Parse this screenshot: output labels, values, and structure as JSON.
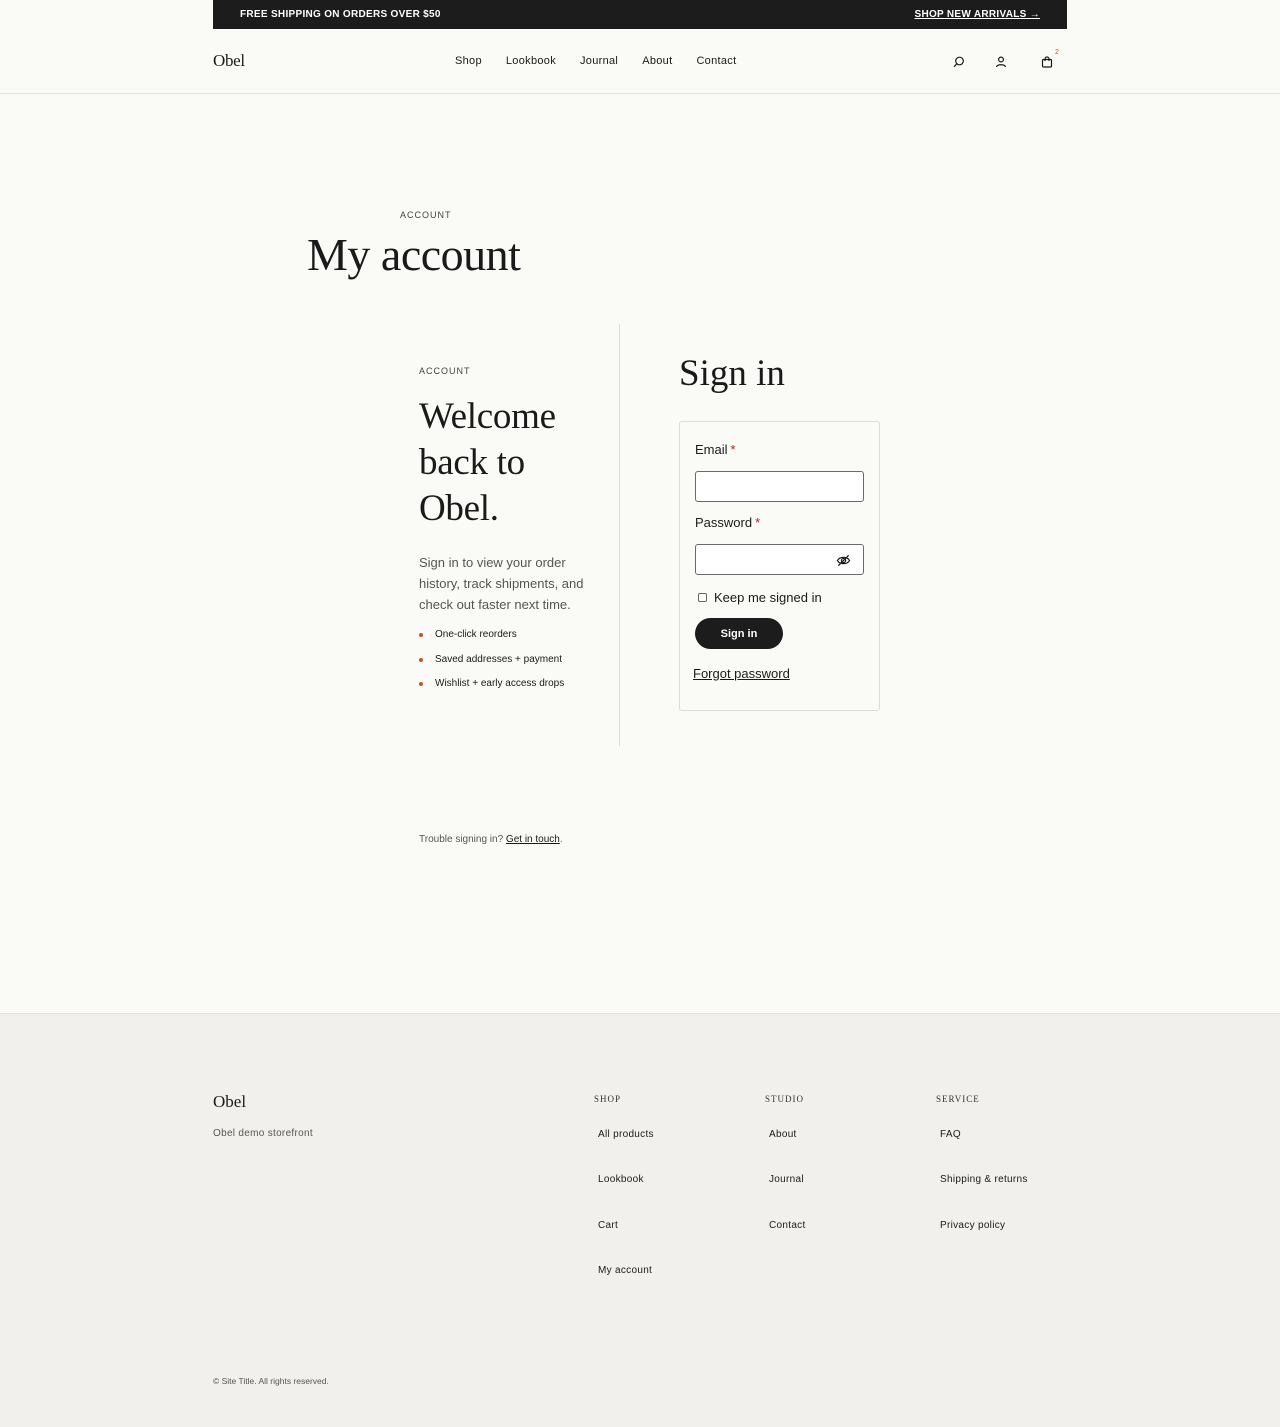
{
  "announcement": {
    "text": "FREE SHIPPING ON ORDERS OVER $50",
    "link": "SHOP NEW ARRIVALS →"
  },
  "header": {
    "logo": "Obel",
    "nav": [
      "Shop",
      "Lookbook",
      "Journal",
      "About",
      "Contact"
    ],
    "icons": [
      "search-icon",
      "account-icon",
      "bag-icon"
    ],
    "cart_count": "2"
  },
  "page": {
    "eyebrow": "ACCOUNT",
    "title": "My account"
  },
  "welcome": {
    "eyebrow": "ACCOUNT",
    "heading": "Welcome back to Obel.",
    "intro": "Sign in to view your order history, track shipments, and check out faster next time.",
    "perks": [
      "One-click reorders",
      "Saved addresses + payment",
      "Wishlist + early access drops"
    ],
    "accent_color": "#c2552b"
  },
  "signin": {
    "title": "Sign in",
    "email_label": "Email",
    "password_label": "Password",
    "required_mark": "*",
    "keep_signed_in": "Keep me signed in",
    "button": "Sign in",
    "forgot": "Forgot password"
  },
  "trouble": {
    "text": "Trouble signing in?",
    "link": "Get in touch",
    "suffix": "."
  },
  "footer": {
    "logo": "Obel",
    "tagline": "Obel demo storefront",
    "columns": [
      {
        "title": "SHOP",
        "links": [
          "All products",
          "Lookbook",
          "Cart",
          "My account"
        ]
      },
      {
        "title": "STUDIO",
        "links": [
          "About",
          "Journal",
          "Contact"
        ]
      },
      {
        "title": "SERVICE",
        "links": [
          "FAQ",
          "Shipping & returns",
          "Privacy policy"
        ]
      }
    ],
    "copyright": "© Site Title. All rights reserved."
  }
}
